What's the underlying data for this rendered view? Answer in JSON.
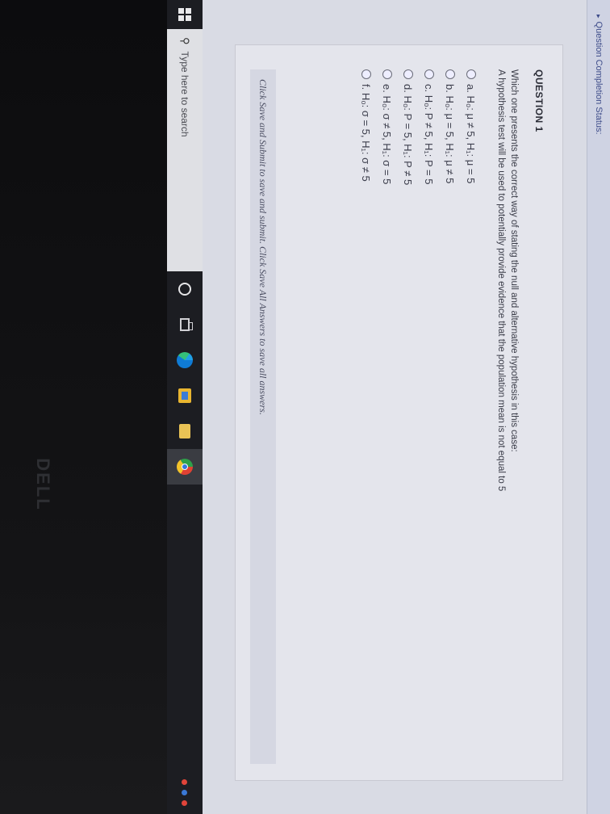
{
  "browser": {
    "status_link": "Question Completion Status:"
  },
  "quiz": {
    "question_title": "QUESTION 1",
    "prompt": "Which one presents the correct way of stating the null and alternative hypothesis in this case:",
    "context": "A hypothesis test will be used to potentially provide evidence that the population mean is not equal to 5",
    "options": [
      {
        "label": "a. H₀: μ ≠ 5, H₁: μ = 5"
      },
      {
        "label": "b. H₀: μ = 5, H₁: μ ≠ 5"
      },
      {
        "label": "c. H₀: P ≠ 5, H₁: P = 5"
      },
      {
        "label": "d. H₀: P = 5, H₁: P ≠ 5"
      },
      {
        "label": "e. H₀: σ ≠ 5, H₁: σ = 5"
      },
      {
        "label": "f. H₀: σ = 5, H₁: σ ≠ 5"
      }
    ],
    "save_note": "Click Save and Submit to save and submit. Click Save All Answers to save all answers."
  },
  "taskbar": {
    "search_placeholder": "Type here to search",
    "icons": [
      "windows-icon",
      "search-icon",
      "cortana-icon",
      "task-view-icon",
      "edge-icon",
      "store-icon",
      "file-explorer-icon",
      "chrome-icon"
    ],
    "tray_colors": [
      "#e0443a",
      "#3a78d5",
      "#e0443a"
    ]
  },
  "hardware": {
    "brand": "DELL"
  }
}
